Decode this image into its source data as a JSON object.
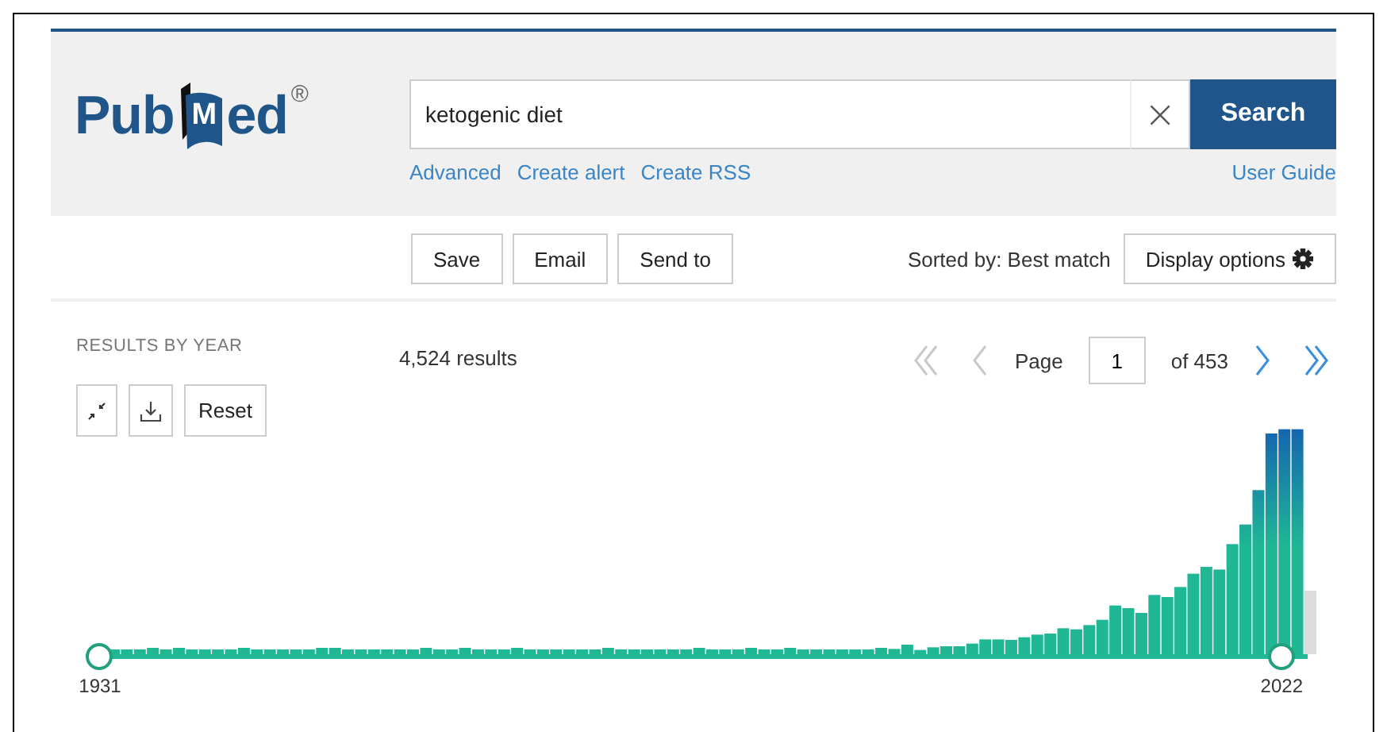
{
  "header": {
    "logo": {
      "left": "Pub",
      "mark": "M",
      "right": "ed",
      "registered": "®"
    },
    "search": {
      "value": "ketogenic diet",
      "clear": "×",
      "button": "Search"
    },
    "links": [
      "Advanced",
      "Create alert",
      "Create RSS"
    ],
    "user_guide": "User Guide"
  },
  "toolbar": {
    "buttons": [
      "Save",
      "Email",
      "Send to"
    ],
    "sort": "Sorted by: Best match",
    "display_options": "Display options"
  },
  "timeline": {
    "title": "RESULTS BY YEAR",
    "controls": [
      {
        "kind": "collapse"
      },
      {
        "kind": "download"
      },
      {
        "kind": "text",
        "label": "Reset"
      }
    ],
    "handles": [
      {
        "label": "1931",
        "level": 0
      },
      {
        "label": "2022",
        "level": 0.985
      }
    ]
  },
  "results": {
    "count": "4,524 results",
    "pagination": {
      "first": {
        "disabled": true
      },
      "previous": {
        "disabled": true
      },
      "page_label": "Page",
      "page": "1",
      "of": "of 453",
      "next": {
        "disabled": false
      },
      "last": {
        "disabled": false
      }
    }
  }
}
